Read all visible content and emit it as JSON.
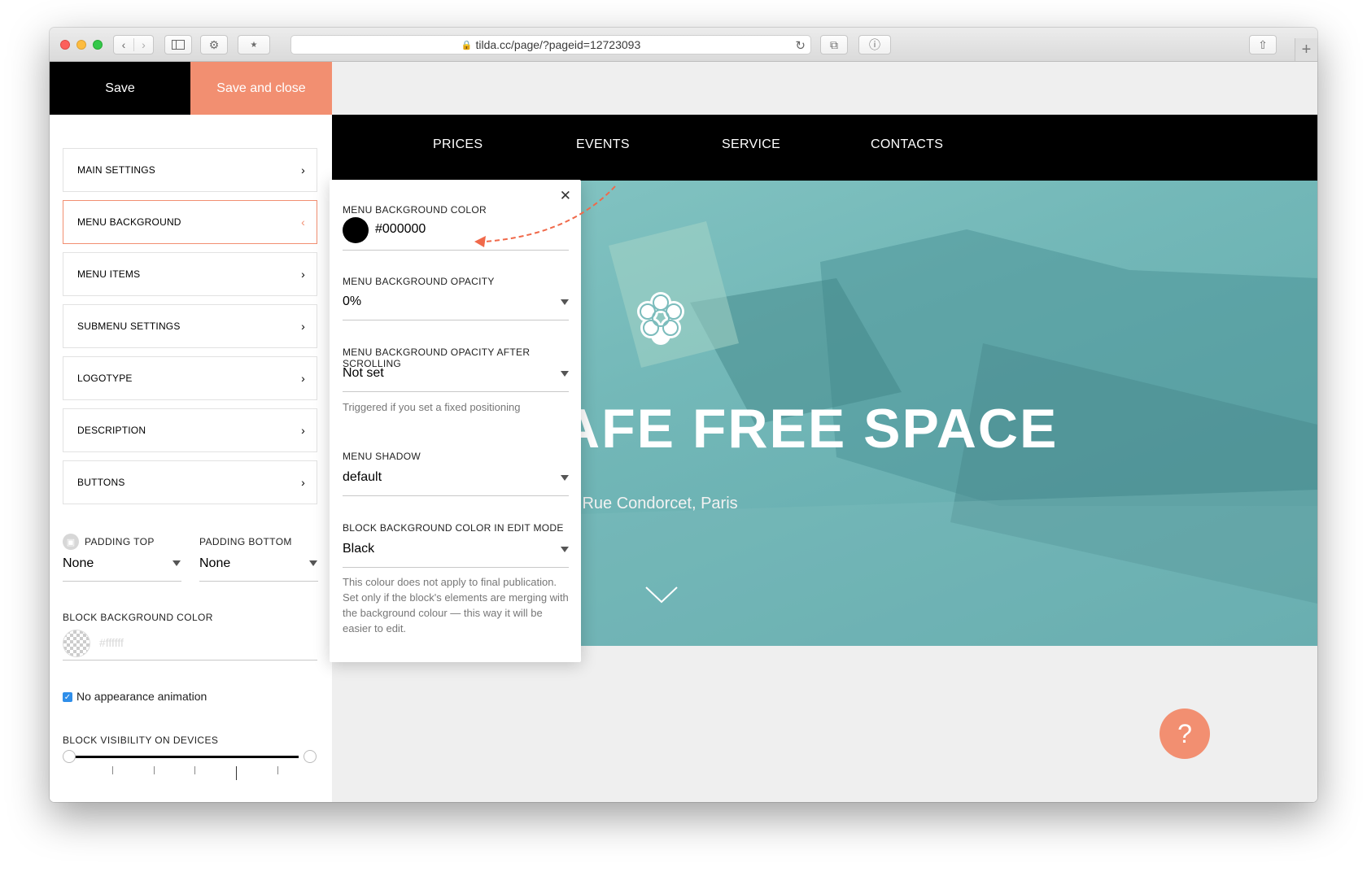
{
  "browser": {
    "url": "tilda.cc/page/?pageid=12723093"
  },
  "toolbar": {
    "save_label": "Save",
    "save_close_label": "Save and close"
  },
  "sidebar": {
    "items": [
      {
        "label": "MAIN SETTINGS",
        "expanded": false
      },
      {
        "label": "MENU BACKGROUND",
        "expanded": true
      },
      {
        "label": "MENU ITEMS",
        "expanded": false
      },
      {
        "label": "SUBMENU SETTINGS",
        "expanded": false
      },
      {
        "label": "LOGOTYPE",
        "expanded": false
      },
      {
        "label": "DESCRIPTION",
        "expanded": false
      },
      {
        "label": "BUTTONS",
        "expanded": false
      }
    ],
    "padding_top_label": "PADDING TOP",
    "padding_top_value": "None",
    "padding_bottom_label": "PADDING BOTTOM",
    "padding_bottom_value": "None",
    "block_bg_label": "BLOCK BACKGROUND COLOR",
    "block_bg_placeholder": "#ffffff",
    "animation_label": "No appearance animation",
    "animation_checked": true,
    "visibility_label": "BLOCK VISIBILITY ON DEVICES"
  },
  "preview": {
    "nav": [
      "PRICES",
      "EVENTS",
      "SERVICE",
      "CONTACTS"
    ],
    "hero_title": "AFE FREE SPACE",
    "hero_subtitle": "A, Rue Condorcet, Paris",
    "accent_color": "#f28f71"
  },
  "popup": {
    "color_label": "MENU BACKGROUND COLOR",
    "color_value": "#000000",
    "opacity_label": "MENU BACKGROUND OPACITY",
    "opacity_value": "0%",
    "opacity_scroll_label": "MENU BACKGROUND OPACITY AFTER SCROLLING",
    "opacity_scroll_value": "Not set",
    "opacity_scroll_hint": "Triggered if you set a fixed positioning",
    "shadow_label": "MENU SHADOW",
    "shadow_value": "default",
    "edit_bg_label": "BLOCK BACKGROUND COLOR IN EDIT MODE",
    "edit_bg_value": "Black",
    "edit_bg_hint": "This colour does not apply to final publication. Set only if the block's elements are merging with the background colour — this way it will be easier to edit."
  },
  "help": {
    "label": "?"
  }
}
